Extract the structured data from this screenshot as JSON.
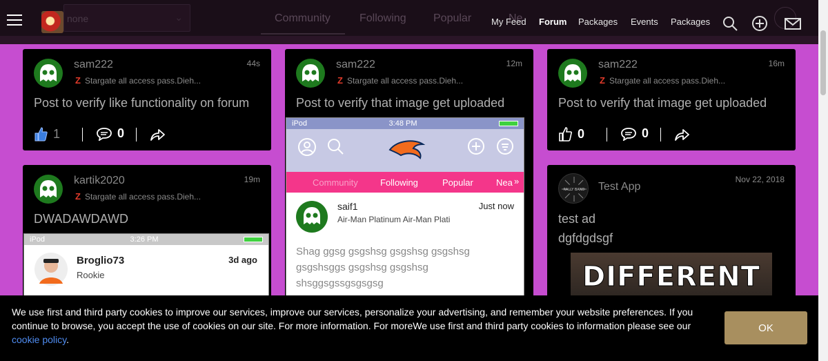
{
  "nav": {
    "ghost_select": "none",
    "ghost_tabs": [
      "Community",
      "Following",
      "Popular",
      "Ne"
    ],
    "links": [
      "My Feed",
      "Forum",
      "Packages",
      "Events",
      "Packages"
    ],
    "active_link": "Forum"
  },
  "cards": [
    {
      "username": "sam222",
      "time": "44s",
      "group": "Stargate all access pass.Dieh...",
      "text": "Post to verify like functionality on forum",
      "likes": "1",
      "comments": "0"
    },
    {
      "username": "sam222",
      "time": "12m",
      "group": "Stargate all access pass.Dieh...",
      "text": "Post to verify that image get uploaded",
      "embed": {
        "carrier": "iPod",
        "clock": "3:48 PM",
        "tabs": [
          "Community",
          "Following",
          "Popular",
          "Nea"
        ],
        "user": "saif1",
        "user_sub": "Air-Man Platinum Air-Man Plati",
        "when": "Just now",
        "body": "Shag ggsg gsgshsg gsgshsg gsgshsg gsgshsggs gsgshsg gsgshsg shsggsgssgsgsgsg"
      }
    },
    {
      "username": "sam222",
      "time": "16m",
      "group": "Stargate all access pass.Dieh...",
      "text": "Post to verify that image get uploaded",
      "likes": "0",
      "comments": "0"
    },
    {
      "username": "kartik2020",
      "time": "19m",
      "group": "Stargate all access pass.Dieh...",
      "text": "DWADAWDAWD",
      "embed": {
        "carrier": "iPod",
        "clock": "3:26 PM",
        "user": "Broglio73",
        "user_sub": "Rookie",
        "when": "3d ago"
      }
    },
    {
      "username": "Test App",
      "time": "Nov 22, 2018",
      "line1": "test ad",
      "line2": "dgfdgdsgf",
      "image_text": "DIFFERENT",
      "avatar_label": "RALLY BAND"
    }
  ],
  "cookie": {
    "text": "We use first and third party cookies to improve our services, improve our services, personalize your advertising, and remember your website preferences. If you continue to browse, you accept the use of cookies on our site. For more information. For moreWe use first and third party cookies to information please see our",
    "link": "cookie policy",
    "after_link": ".",
    "ok": "OK"
  },
  "colors": {
    "page_bg": "#c64dd0",
    "card_bg": "#000000",
    "avatar_green": "#1e7a1e",
    "ok_button": "#a88f5f",
    "link": "#4f8cf0"
  }
}
